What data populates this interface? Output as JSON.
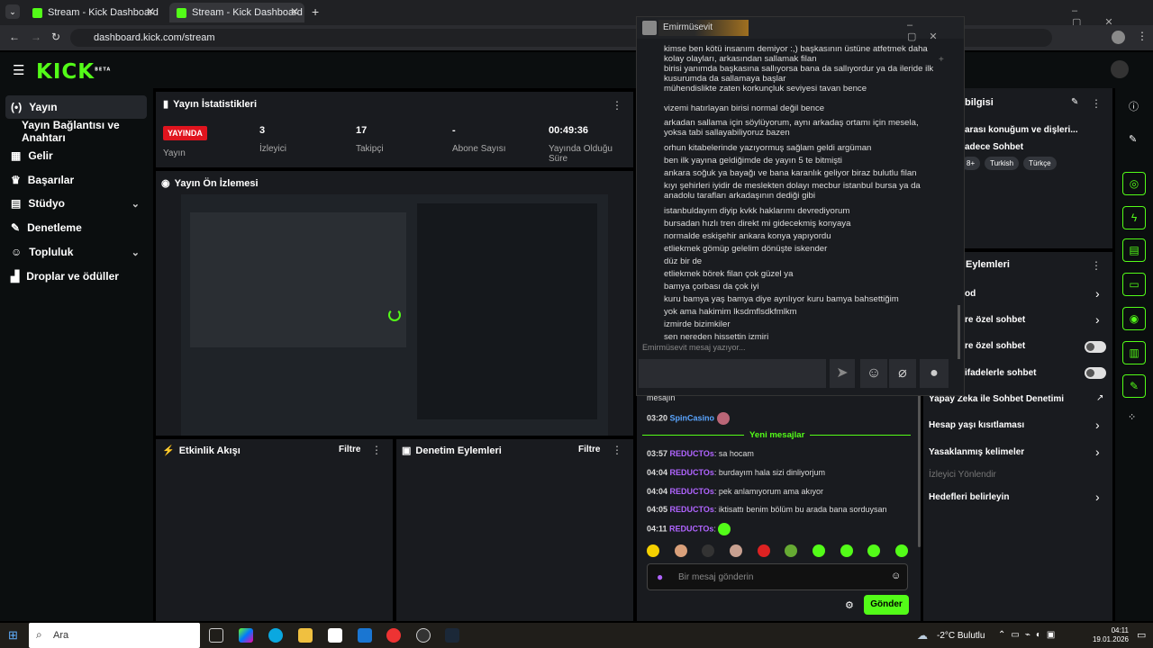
{
  "browser": {
    "tabs": [
      {
        "title": "Stream - Kick Dashboard"
      },
      {
        "title": "Stream - Kick Dashboard"
      }
    ],
    "url": "dashboard.kick.com/stream"
  },
  "header": {
    "logo": "KICK",
    "logo_sup": "BETA"
  },
  "sidebar": {
    "items": [
      {
        "label": "Yayın"
      },
      {
        "label": "Yayın Bağlantısı ve Anahtarı"
      },
      {
        "label": "Gelir"
      },
      {
        "label": "Başarılar"
      },
      {
        "label": "Stüdyo"
      },
      {
        "label": "Denetleme"
      },
      {
        "label": "Topluluk"
      },
      {
        "label": "Droplar ve ödüller"
      }
    ]
  },
  "stats": {
    "title": "Yayın İstatistikleri",
    "badge": "YAYINDA",
    "badge_sub": "Yayın",
    "items": [
      {
        "value": "3",
        "label": "İzleyici"
      },
      {
        "value": "17",
        "label": "Takipçi"
      },
      {
        "value": "-",
        "label": "Abone Sayısı"
      },
      {
        "value": "00:49:36",
        "label": "Yayında Olduğu Süre"
      }
    ]
  },
  "preview": {
    "title": "Yayın Ön İzlemesi"
  },
  "activity": {
    "title": "Etkinlik Akışı",
    "filter": "Filtre"
  },
  "moderation": {
    "title": "Denetim Eylemleri",
    "filter": "Filtre"
  },
  "stream_info": {
    "title_partial": "bilgisi",
    "stream_title": "arası konuğum ve dişleri...",
    "category": "adece Sohbet",
    "tags": [
      "8+",
      "Turkish",
      "Türkçe"
    ]
  },
  "chat_settings": {
    "title_partial": "Eylemleri",
    "items": [
      {
        "label": "od",
        "control": "arrow"
      },
      {
        "label": "re özel sohbet",
        "control": "arrow"
      },
      {
        "label": "re özel sohbet",
        "control": "toggle"
      },
      {
        "label": "ifadelerle sohbet",
        "control": "toggle"
      },
      {
        "label": "Yapay Zeka ile Sohbet Denetimi",
        "control": "external"
      },
      {
        "label": "Hesap yaşı kısıtlaması",
        "control": "arrow"
      },
      {
        "label": "Yasaklanmış kelimeler",
        "control": "arrow"
      },
      {
        "label": "İzleyici Yönlendir",
        "control": "none"
      },
      {
        "label": "Hedefleri belirleyin",
        "control": "arrow"
      }
    ]
  },
  "chat": {
    "partial_line": "mesajın",
    "messages": [
      {
        "time": "03:20",
        "user": "SpinCasino",
        "text": "",
        "user_color": "#5aa5ff"
      },
      {
        "time": "03:57",
        "user": "REDUCTOs",
        "text": "sa hocam"
      },
      {
        "time": "04:04",
        "user": "REDUCTOs",
        "text": "burdayım hala sizi dinliyorjum"
      },
      {
        "time": "04:04",
        "user": "REDUCTOs",
        "text": "pek anlamıyorum ama akıyor"
      },
      {
        "time": "04:05",
        "user": "REDUCTOs",
        "text": "iktisattı benim bölüm bu arada bana sorduysan"
      },
      {
        "time": "04:11",
        "user": "REDUCTOs",
        "text": ""
      }
    ],
    "new_messages": "Yeni mesajlar",
    "placeholder": "Bir mesaj gönderin",
    "send": "Gönder"
  },
  "popup": {
    "username": "Emirmüsevit",
    "lines": [
      "kimse ben kötü insanım demiyor :,) başkasının üstüne atfetmek daha kolay olayları, arkasından sallamak filan",
      "birisi yanımda başkasına sallıyorsa bana da sallıyordur ya da ileride ilk kusurumda da sallamaya başlar",
      "mühendislikte zaten korkunçluk seviyesi tavan bence",
      "vizemi hatırlayan birisi normal değil bence",
      "arkadan sallama için söylüyorum, aynı arkadaş ortamı için mesela, yoksa tabi sallayabiliyoruz bazen",
      "orhun kitabelerinde yazıyormuş sağlam geldi argüman",
      "ben ilk yayına geldiğimde de yayın 5 te bitmişti",
      "ankara soğuk ya bayağı ve bana karanlık geliyor biraz bulutlu filan",
      "kıyı şehirleri iyidir de meslekten dolayı mecbur istanbul bursa ya da anadolu tarafları arkadaşının dediği gibi",
      "istanbuldayım diyip kvkk haklarımı devrediyorum",
      "bursadan hızlı tren direkt mi gidecekmiş konyaya",
      "normalde eskişehir ankara konya yapıyordu",
      "etliekmek gömüp gelelim dönüşte iskender",
      "düz bir de",
      "etliekmek börek filan çok güzel ya",
      "bamya çorbası da çok iyi",
      "kuru bamya yaş bamya diye ayrılıyor kuru bamya bahsettiğim",
      "yok ama hakimim lksdmflsdkfmlkm",
      "izmirde bizimkiler",
      "sen nereden hissettin izmiri"
    ],
    "typing": "Emirmüsevit mesaj yazıyor..."
  },
  "taskbar": {
    "search": "Ara",
    "weather": "-2°C Bulutlu",
    "time": "04:11",
    "date": "19.01.2026"
  },
  "colors": {
    "brand": "#53fc18",
    "live": "#e0141e",
    "username": "#b064ff"
  }
}
